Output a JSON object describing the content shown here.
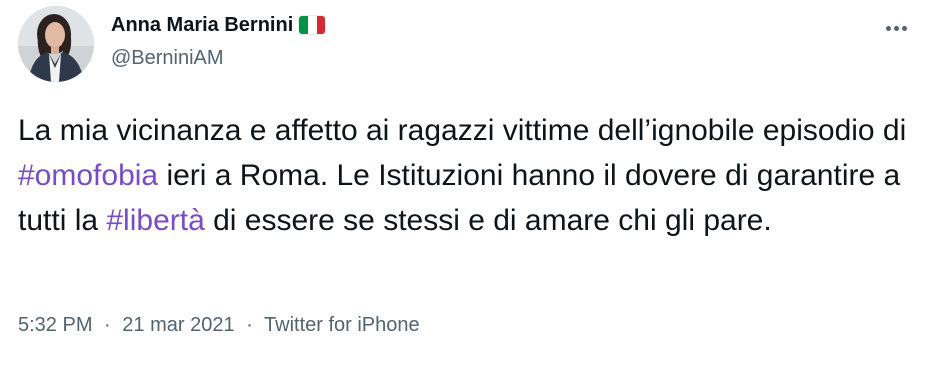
{
  "author": {
    "display_name": "Anna Maria Bernini",
    "handle": "@BerniniAM",
    "flag_icon": "italy-flag-icon",
    "flag_colors": [
      "#009246",
      "#ffffff",
      "#ce2b37"
    ]
  },
  "tweet": {
    "segments": {
      "s1": "La mia vicinanza e affetto ai ragazzi vittime dell’ignobile episodio di ",
      "h1": "#omofobia",
      "s2": " ieri a Roma. Le Istituzioni hanno il dovere di garantire a tutti la ",
      "h2": "#libertà",
      "s3": " di essere se stessi e di amare chi gli pare."
    },
    "hashtag_color": "#794bc4"
  },
  "meta": {
    "time": "5:32 PM",
    "separator": "·",
    "date": "21 mar 2021",
    "source": "Twitter for iPhone"
  },
  "icons": {
    "more": "more-options-icon"
  }
}
